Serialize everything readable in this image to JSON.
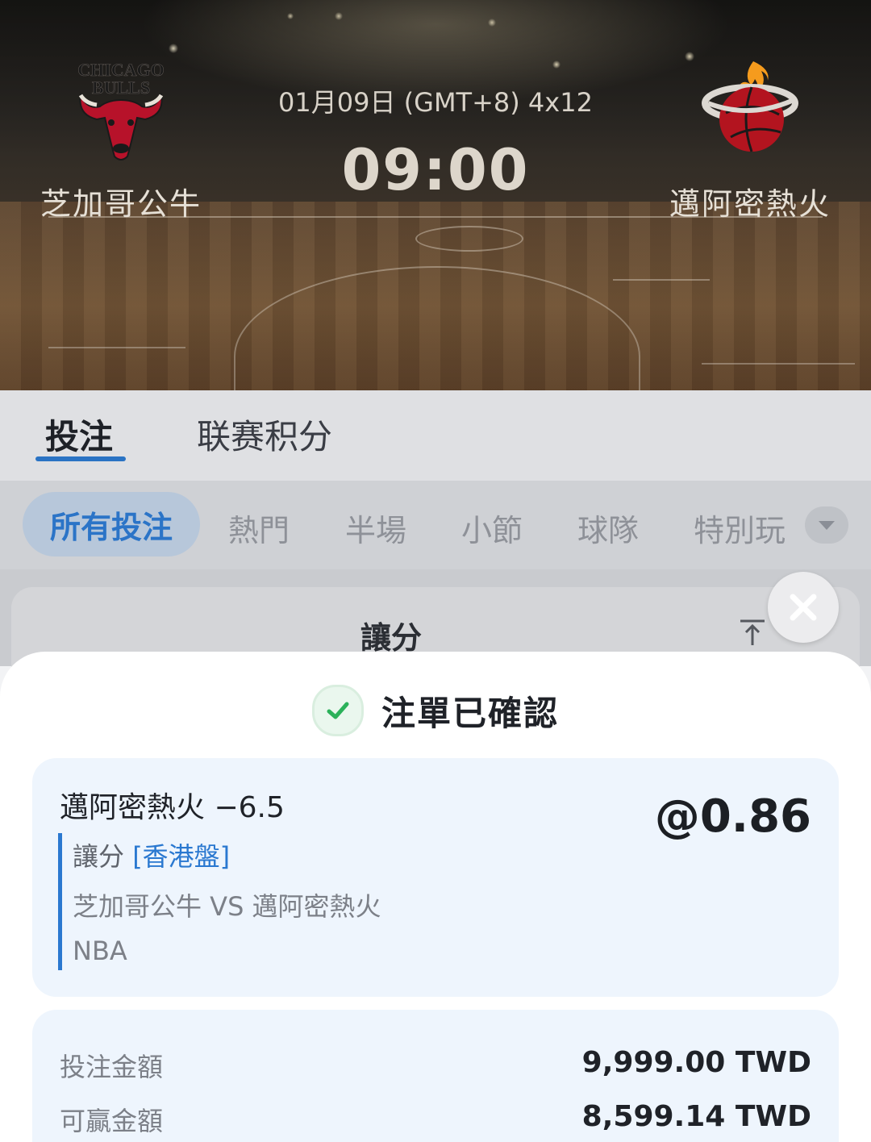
{
  "match": {
    "home_team": "芝加哥公牛",
    "away_team": "邁阿密熱火",
    "date_line": "01月09日  (GMT+8) 4x12",
    "time": "09:00",
    "home_logo_text_1": "CHICAGO",
    "home_logo_text_2": "BULLS"
  },
  "main_tabs": [
    {
      "label": "投注",
      "active": true
    },
    {
      "label": "联赛积分",
      "active": false
    }
  ],
  "sub_tabs": [
    {
      "label": "所有投注",
      "active": true
    },
    {
      "label": "熱門",
      "active": false
    },
    {
      "label": "半場",
      "active": false
    },
    {
      "label": "小節",
      "active": false
    },
    {
      "label": "球隊",
      "active": false
    },
    {
      "label": "特別玩",
      "active": false
    }
  ],
  "market": {
    "title": "讓分"
  },
  "confirmation": {
    "title": "注單已確認",
    "selection": "邁阿密熱火 −6.5",
    "odds": "@0.86",
    "market_name": "讓分",
    "odds_format": "[香港盤]",
    "matchup": "芝加哥公牛 VS 邁阿密熱火",
    "league": "NBA"
  },
  "amounts": {
    "stake_label": "投注金額",
    "stake_value": "9,999.00 TWD",
    "win_label": "可贏金額",
    "win_value": "8,599.14 TWD"
  },
  "icons": {
    "close": "close-icon",
    "check": "check-icon",
    "collapse": "collapse-to-top-icon",
    "more": "chevron-down-icon"
  },
  "colors": {
    "accent": "#2a78d0",
    "success": "#2bb15a",
    "sheet_bg": "#ffffff",
    "card_bg": "#eef5fd"
  }
}
